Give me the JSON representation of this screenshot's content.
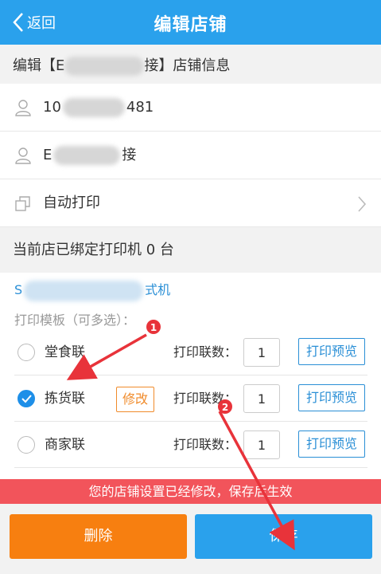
{
  "header": {
    "back_label": "返回",
    "title": "编辑店铺"
  },
  "section": {
    "prefix": "编辑【E",
    "suffix": "接】店铺信息"
  },
  "info_rows": [
    {
      "icon": "user-icon",
      "prefix": "10",
      "suffix": "481"
    },
    {
      "icon": "user-icon",
      "prefix": "E",
      "suffix": "接"
    },
    {
      "icon": "printer-icon",
      "label": "自动打印"
    }
  ],
  "bound_printers": "当前店已绑定打印机 0 台",
  "printer": {
    "prefix": "S",
    "suffix": "式机"
  },
  "template_label": "打印模板（可多选）：",
  "templates": [
    {
      "name": "堂食联",
      "checked": false,
      "copies_label": "打印联数：",
      "copies": "1",
      "preview": "打印预览"
    },
    {
      "name": "拣货联",
      "checked": true,
      "edit": "修改",
      "copies_label": "打印联数：",
      "copies": "1",
      "preview": "打印预览"
    },
    {
      "name": "商家联",
      "checked": false,
      "copies_label": "打印联数：",
      "copies": "1",
      "preview": "打印预览"
    }
  ],
  "notice": "您的店铺设置已经修改，保存后生效",
  "buttons": {
    "delete": "删除",
    "save": "保存"
  },
  "annotations": [
    "1",
    "2"
  ],
  "colors": {
    "primary": "#2aa1ec",
    "orange": "#f77f10",
    "notice_red": "#f2545b",
    "arrow_red": "#e8333a"
  }
}
